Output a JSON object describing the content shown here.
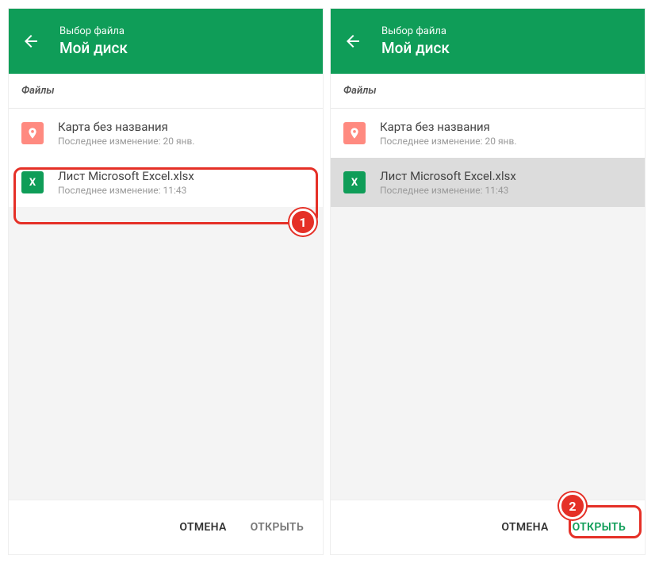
{
  "header": {
    "subtitle": "Выбор файла",
    "title": "Мой диск"
  },
  "section_label": "Файлы",
  "files": [
    {
      "icon": "map",
      "title": "Карта без названия",
      "sub": "Последнее изменение: 20 янв."
    },
    {
      "icon": "excel",
      "title": "Лист Microsoft Excel.xlsx",
      "sub": "Последнее изменение: 11:43"
    }
  ],
  "footer": {
    "cancel": "ОТМЕНА",
    "open": "ОТКРЫТЬ"
  },
  "steps": {
    "s1": "1",
    "s2": "2"
  }
}
